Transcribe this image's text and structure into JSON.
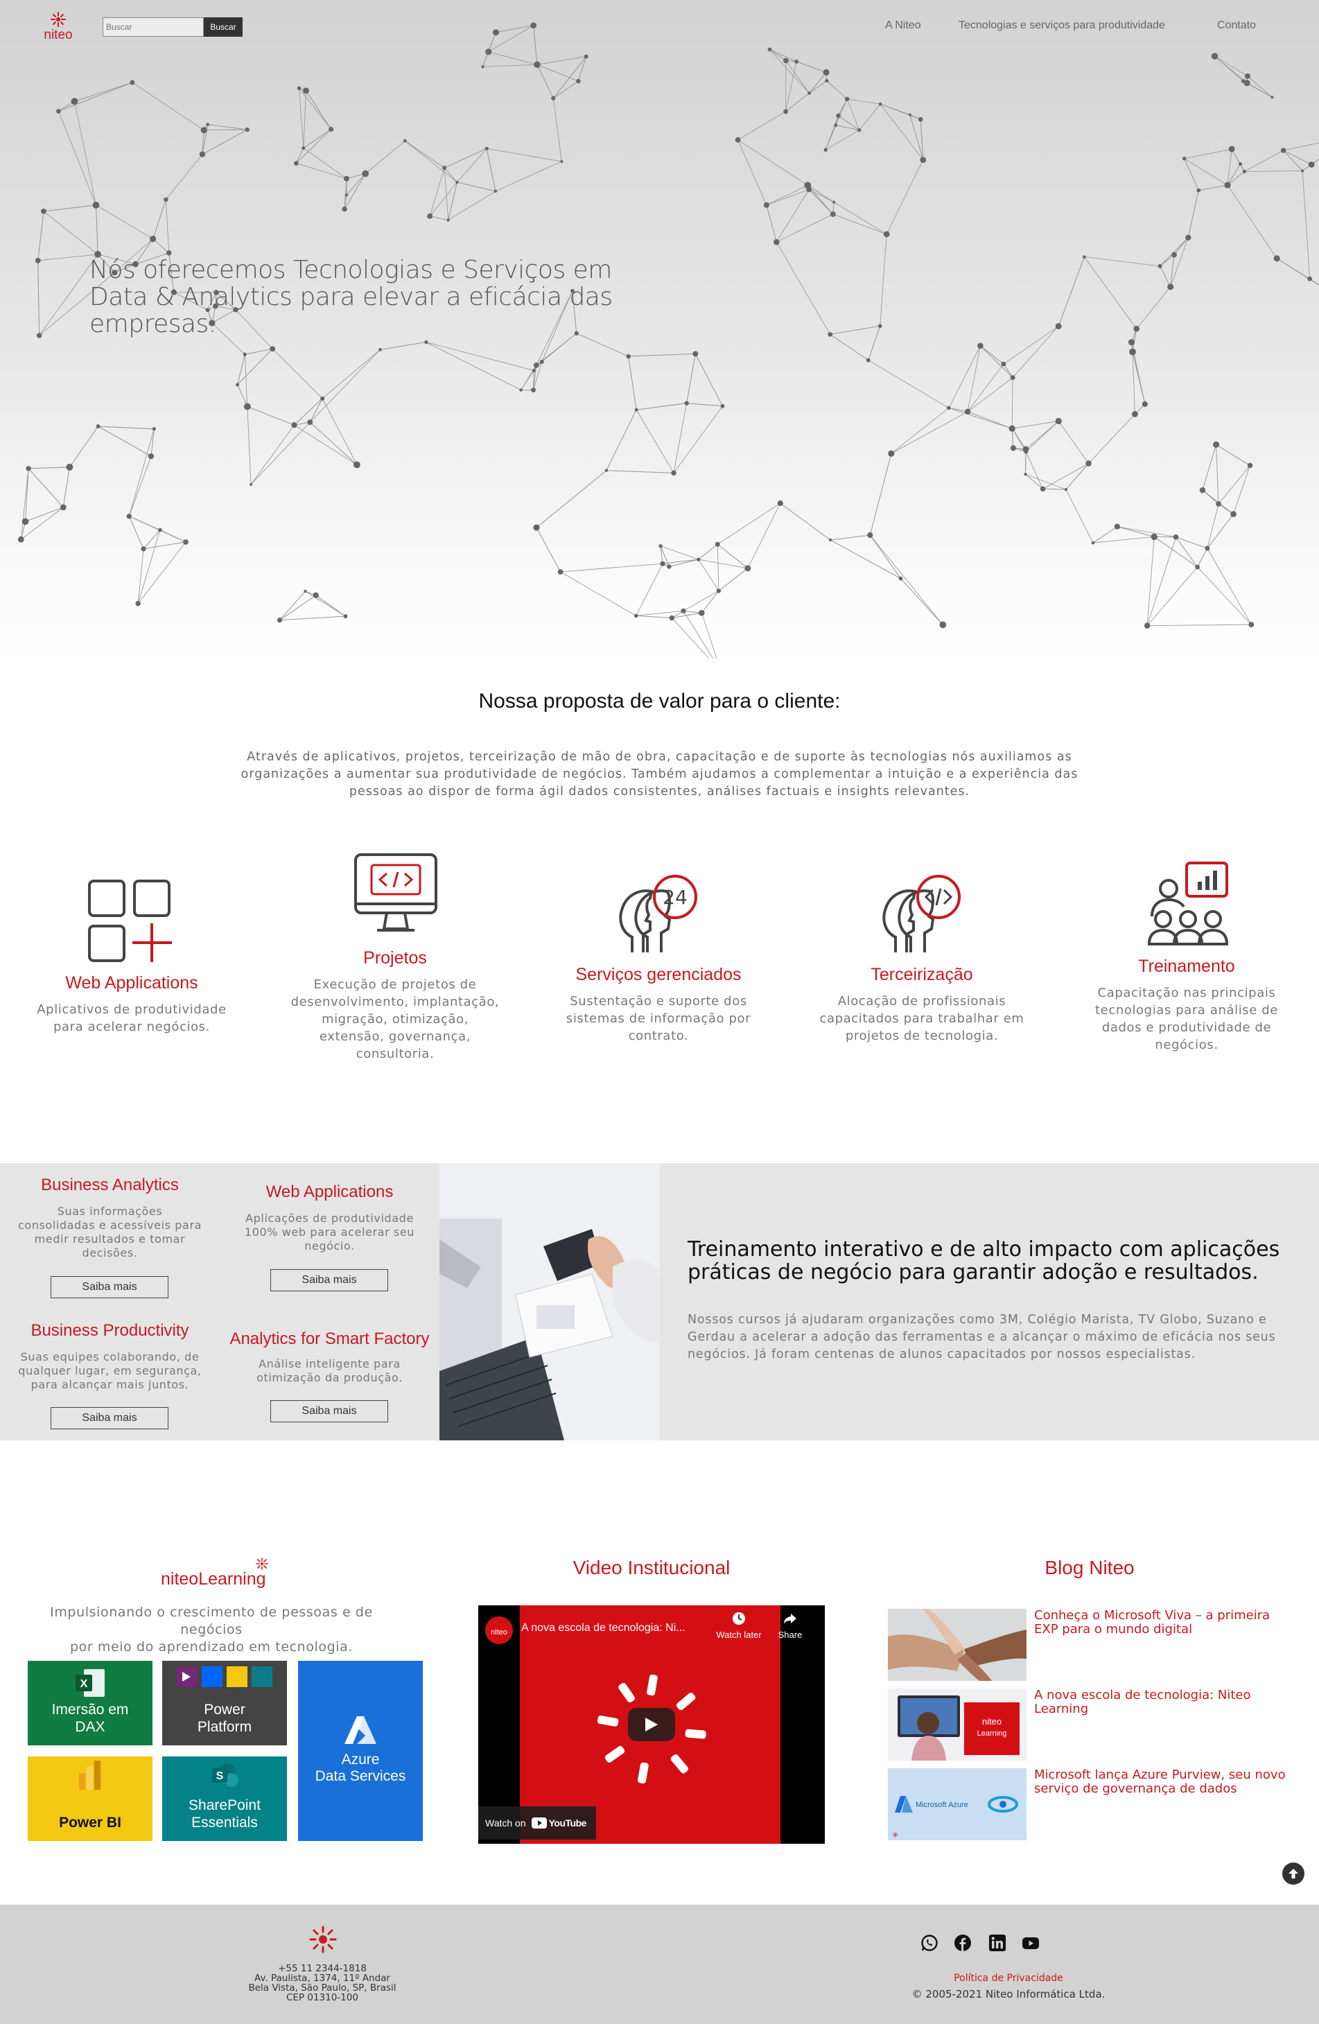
{
  "header": {
    "search_placeholder": "Buscar",
    "search_button": "Buscar",
    "nav": [
      "A Niteo",
      "Tecnologias e serviços para produtividade",
      "Contato"
    ]
  },
  "hero": {
    "title_lines": [
      "Nós oferecemos Tecnologias e Serviços em",
      "Data & Analytics para elevar a eficácia das",
      "empresas."
    ]
  },
  "value": {
    "title": "Nossa proposta de valor para o cliente:",
    "text_lines": [
      "Através de aplicativos, projetos, terceirização de mão de obra, capacitação e de suporte às tecnologias nós auxiliamos as",
      "organizações a aumentar sua produtividade de negócios. Também ajudamos a complementar a intuição e a experiência das",
      "pessoas ao dispor de forma ágil dados consistentes, análises factuais e insights relevantes."
    ]
  },
  "services": [
    {
      "icon": "grid-plus-icon",
      "title": "Web Applications",
      "lines": [
        "Aplicativos de produtividade",
        "para acelerar negócios."
      ]
    },
    {
      "icon": "monitor-code-icon",
      "title": "Projetos",
      "lines": [
        "Execução de projetos de",
        "desenvolvimento, implantação,",
        "migração, otimização,",
        "extensão, governança,",
        "consultoria."
      ]
    },
    {
      "icon": "head-24h-icon",
      "title": "Serviços gerenciados",
      "lines": [
        "Sustentação e suporte dos",
        "sistemas de informação por",
        "contrato."
      ]
    },
    {
      "icon": "head-code-icon",
      "title": "Terceirização",
      "lines": [
        "Alocação de profissionais",
        "capacitados para trabalhar em",
        "projetos de tecnologia."
      ]
    },
    {
      "icon": "team-chart-icon",
      "title": "Treinamento",
      "lines": [
        "Capacitação nas principais",
        "tecnologias para análise de",
        "dados e produtividade de",
        "negócios."
      ]
    }
  ],
  "solutions": [
    {
      "title": "Business Analytics",
      "lines": [
        "Suas informações",
        "consolidadas e acessíveis para",
        "medir resultados e tomar",
        "decisões."
      ],
      "button": "Saiba mais"
    },
    {
      "title": "Web Applications",
      "lines": [
        "Aplicações de produtividade",
        "100% web para acelerar seu",
        "negócio."
      ],
      "button": "Saiba mais"
    },
    {
      "title": "Business Productivity",
      "lines": [
        "Suas equipes colaborando, de",
        "qualquer lugar, em segurança,",
        "para alcançar mais juntos."
      ],
      "button": "Saiba mais"
    },
    {
      "title": "Analytics for Smart Factory",
      "lines": [
        "Análise inteligente para",
        "otimização da produção."
      ],
      "button": "Saiba mais"
    }
  ],
  "training": {
    "title_lines": [
      "Treinamento interativo e de alto impacto com aplicações",
      "práticas de negócio para garantir adoção e resultados."
    ],
    "text_lines": [
      "Nossos cursos já ajudaram organizações como 3M, Colégio Marista, TV Globo, Suzano e",
      "Gerdau a acelerar a adoção das ferramentas e a alcançar o máximo de eficácia nos seus",
      "negócios. Já foram centenas de alunos capacitados por nossos especialistas."
    ]
  },
  "learning": {
    "logo_word1": "niteo",
    "logo_word2": "Learning",
    "text_lines": [
      "Impulsionando o crescimento de pessoas e de negócios",
      "por meio do aprendizado em tecnologia."
    ],
    "tiles": [
      {
        "lines": [
          "Imersão em",
          "DAX"
        ],
        "color": "#107c41"
      },
      {
        "lines": [
          "Power",
          "Platform"
        ],
        "color": "#444444"
      },
      {
        "lines": [
          "Azure",
          "Data Services"
        ],
        "color": "#1a6fd8"
      },
      {
        "lines": [
          "Power BI"
        ],
        "color": "#f2c811"
      },
      {
        "lines": [
          "SharePoint",
          "Essentials"
        ],
        "color": "#038387"
      }
    ]
  },
  "video": {
    "title": "Video Institucional",
    "caption": "A nova escola de tecnologia: Ni...",
    "watch_later": "Watch later",
    "share": "Share",
    "watch_on": "Watch on",
    "youtube": "YouTube"
  },
  "blog": {
    "title": "Blog Niteo",
    "posts": [
      {
        "lines": [
          "Conheça o Microsoft Viva – a primeira",
          "EXP para o mundo digital"
        ]
      },
      {
        "lines": [
          "A nova escola de tecnologia: Niteo",
          "Learning"
        ]
      },
      {
        "lines": [
          "Microsoft lança Azure Purview, seu novo",
          "serviço de governança de dados"
        ]
      }
    ],
    "azure_label": "Microsoft Azure"
  },
  "footer": {
    "phone": "+55 11 2344-1818",
    "address_lines": [
      "Av. Paulista, 1374, 11º Andar",
      "Bela Vista, São Paulo, SP, Brasil",
      "CEP 01310-100"
    ],
    "privacy": "Política de Privacidade",
    "copyright": "© 2005-2021 Niteo Informática Ltda."
  },
  "logo": {
    "text": "niteo"
  },
  "colors": {
    "brand_red": "#c8191f",
    "gray_band": "#e5e5e5",
    "footer": "#d2d2d2"
  }
}
